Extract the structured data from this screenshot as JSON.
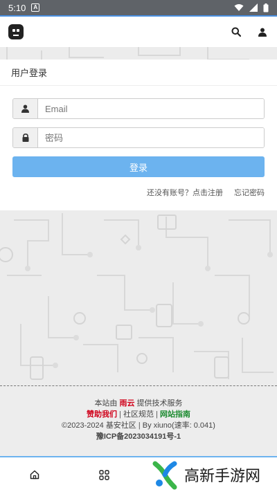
{
  "status_bar": {
    "time": "5:10",
    "notif_letter": "A"
  },
  "nav": {
    "logo": "robot-logo",
    "icons": [
      "search-icon",
      "user-icon"
    ]
  },
  "login": {
    "title": "用户登录",
    "email_placeholder": "Email",
    "password_placeholder": "密码",
    "submit_label": "登录",
    "register_link": "还没有账号？点击注册",
    "forgot_link": "忘记密码"
  },
  "footer": {
    "line1_prefix": "本站由",
    "line1_brand": "雨云",
    "line1_suffix": "提供技术服务",
    "sponsor": "赞助我们",
    "rules": "社区规范",
    "guide": "网站指南",
    "sep": "|",
    "copyright": "©2023-2024 基安社区",
    "powered": "By xiuno(速率: 0.041)",
    "icp": "豫ICP备2023034191号-1"
  },
  "bottom_nav": {
    "icons": [
      "home-icon",
      "grid-icon"
    ]
  },
  "watermark": {
    "text": "高新手游网"
  },
  "colors": {
    "primary": "#6cb3ef",
    "red": "#d0021b",
    "green": "#1b8a2f",
    "status_bar": "#5f6368"
  }
}
